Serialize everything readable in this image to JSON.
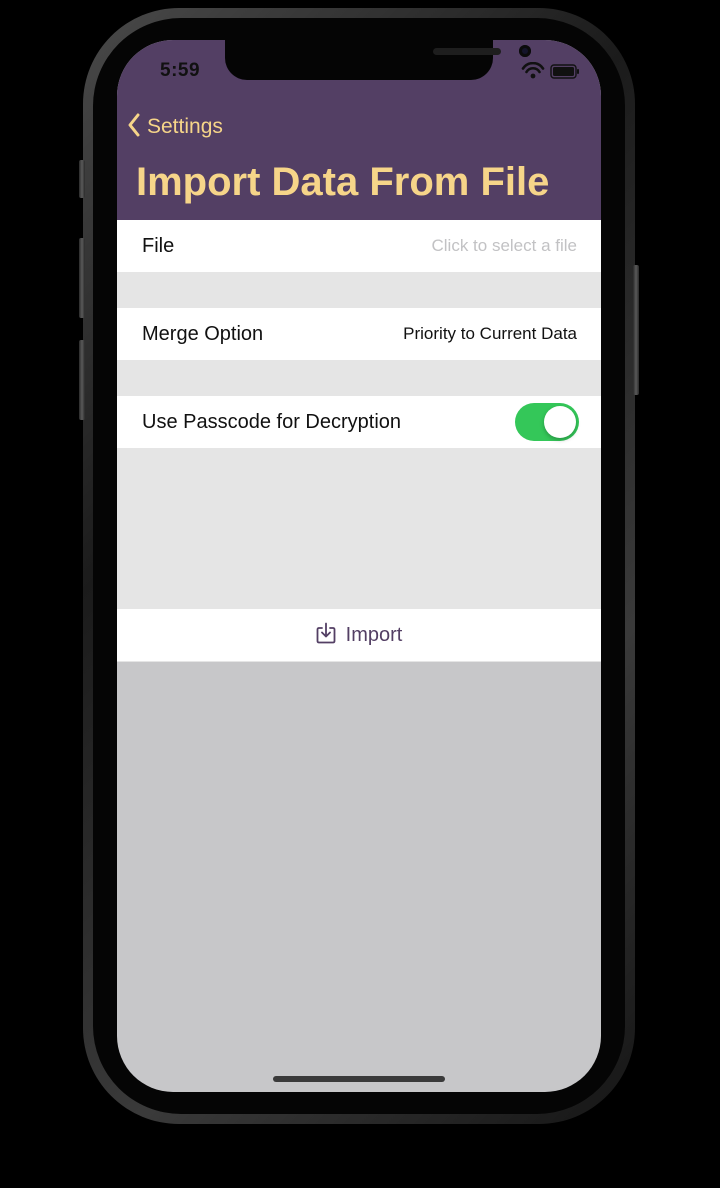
{
  "status_bar": {
    "time": "5:59",
    "icons": [
      "wifi-icon",
      "battery-icon"
    ]
  },
  "nav": {
    "back_label": "Settings",
    "back_icon": "chevron-left-icon",
    "title": "Import Data From File"
  },
  "form": {
    "file": {
      "label": "File",
      "placeholder": "Click to select a file"
    },
    "merge": {
      "label": "Merge Option",
      "value": "Priority to Current Data"
    },
    "passcode": {
      "label": "Use Passcode for Decryption",
      "enabled": true
    },
    "import_button": {
      "label": "Import",
      "icon": "import-icon"
    }
  },
  "colors": {
    "nav_background": "#533f64",
    "accent_yellow": "#f6d589",
    "toggle_on": "#34c759",
    "grouped_background": "#e5e5e5",
    "screen_background": "#c7c7c9"
  }
}
